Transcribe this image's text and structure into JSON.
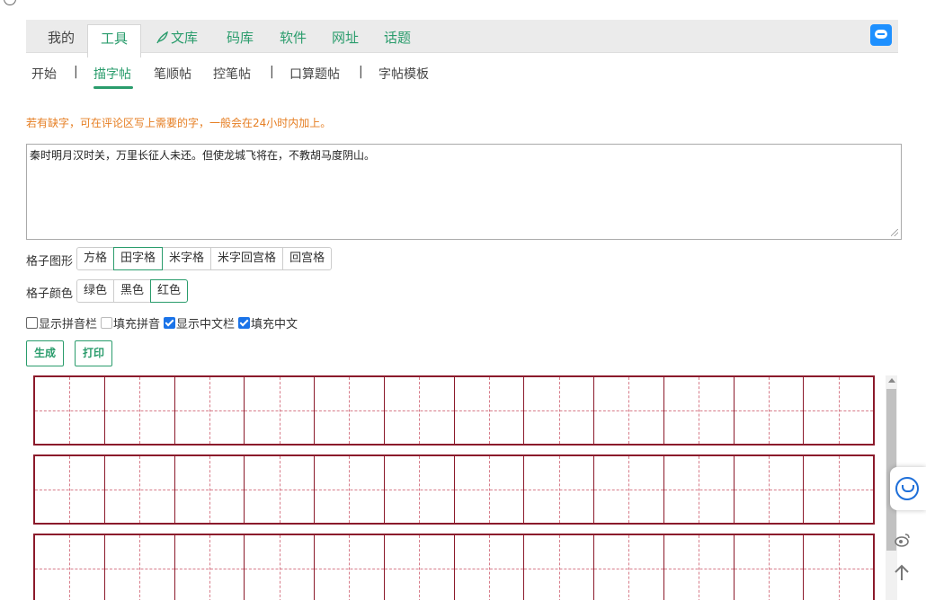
{
  "top_tabs": [
    {
      "label": "我的"
    },
    {
      "label": "工具"
    },
    {
      "label": "文库"
    },
    {
      "label": "码库"
    },
    {
      "label": "软件"
    },
    {
      "label": "网址"
    },
    {
      "label": "话题"
    }
  ],
  "sub_tabs": [
    "开始",
    "描字帖",
    "笔顺帖",
    "控笔帖",
    "口算题帖",
    "字帖模板"
  ],
  "separator": "|",
  "notice": "若有缺字，可在评论区写上需要的字，一般会在24小时内加上。",
  "input_text": "秦时明月汉时关，万里长征人未还。但使龙城飞将在，不教胡马度阴山。",
  "grid_shape": {
    "label": "格子图形",
    "options": [
      "方格",
      "田字格",
      "米字格",
      "米字回宫格",
      "回宫格"
    ],
    "selected": "田字格"
  },
  "grid_color": {
    "label": "格子颜色",
    "options": [
      "绿色",
      "黑色",
      "红色"
    ],
    "selected": "红色"
  },
  "checkboxes": [
    {
      "label": "显示拼音栏",
      "checked": false
    },
    {
      "label": "填充拼音",
      "checked": false
    },
    {
      "label": "显示中文栏",
      "checked": true
    },
    {
      "label": "填充中文",
      "checked": true
    }
  ],
  "buttons": {
    "generate": "生成",
    "print": "打印"
  },
  "preview": {
    "cells_per_row": 12,
    "rows_visible": 3
  },
  "colors": {
    "accent": "#2a9c6c",
    "grid_line": "#8b1a2b",
    "notice": "#e67e22"
  }
}
